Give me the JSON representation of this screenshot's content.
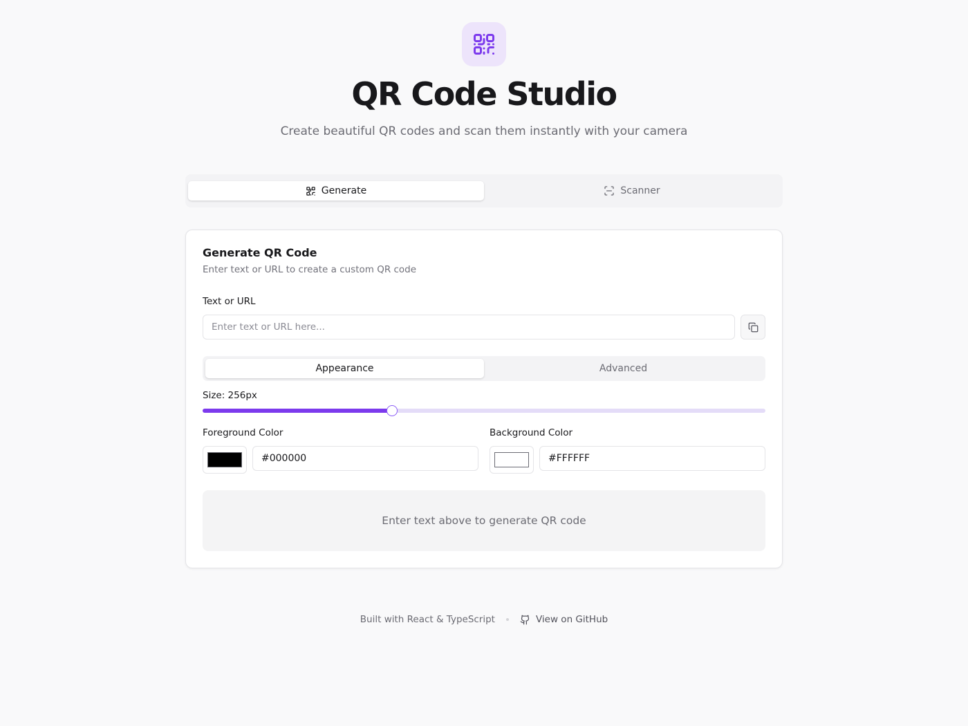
{
  "header": {
    "title": "QR Code Studio",
    "subtitle": "Create beautiful QR codes and scan them instantly with your camera",
    "logo_icon": "qr-code-icon"
  },
  "main_tabs": [
    {
      "label": "Generate",
      "icon": "qr-code-icon",
      "active": true
    },
    {
      "label": "Scanner",
      "icon": "scan-icon",
      "active": false
    }
  ],
  "card": {
    "title": "Generate QR Code",
    "description": "Enter text or URL to create a custom QR code",
    "text_label": "Text or URL",
    "text_value": "",
    "text_placeholder": "Enter text or URL here...",
    "copy_icon": "copy-icon"
  },
  "sub_tabs": [
    {
      "label": "Appearance",
      "active": true
    },
    {
      "label": "Advanced",
      "active": false
    }
  ],
  "appearance": {
    "size_label": "Size: 256px",
    "size_fraction": 0.337,
    "foreground_label": "Foreground Color",
    "foreground_value": "#000000",
    "background_label": "Background Color",
    "background_value": "#FFFFFF"
  },
  "empty_state": "Enter text above to generate QR code",
  "footer": {
    "built_with": "Built with React & TypeScript",
    "github_label": "View on GitHub",
    "github_icon": "github-icon"
  },
  "colors": {
    "accent": "#7c3aed",
    "accent_light": "#ede4fb",
    "track": "#e4dcf8"
  }
}
